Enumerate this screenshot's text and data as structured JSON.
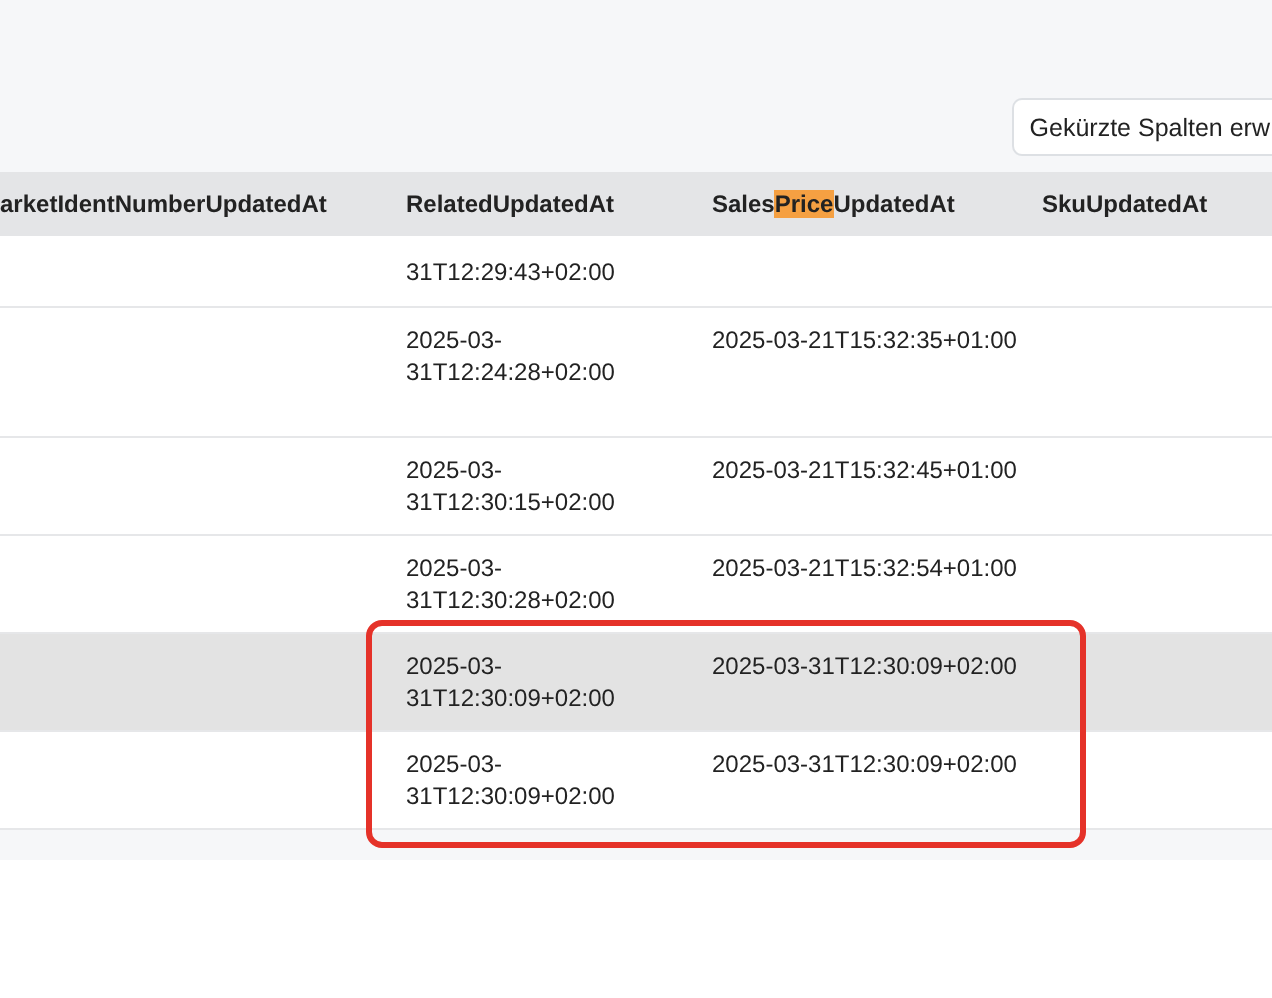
{
  "toolbar": {
    "button": "Gekürzte Spalten erw"
  },
  "table": {
    "columns": [
      {
        "parts": [
          {
            "text": "arketIdentNumberUpdatedAt",
            "highlighted": false
          }
        ]
      },
      {
        "parts": [
          {
            "text": "RelatedUpdatedAt",
            "highlighted": false
          }
        ]
      },
      {
        "parts": [
          {
            "text": "Sales",
            "highlighted": false
          },
          {
            "text": "Price",
            "highlighted": true
          },
          {
            "text": "UpdatedAt",
            "highlighted": false
          }
        ]
      },
      {
        "parts": [
          {
            "text": "SkuUpdatedAt",
            "highlighted": false
          }
        ]
      }
    ],
    "rows": [
      {
        "related": "31T12:29:43+02:00",
        "hovered": false
      },
      {
        "related": "2025-03-31T12:24:28+02:00",
        "sales_price": "2025-03-21T15:32:35+01:00",
        "hovered": false
      },
      {
        "related": "2025-03-31T12:30:15+02:00",
        "sales_price": "2025-03-21T15:32:45+01:00",
        "hovered": false
      },
      {
        "related": "2025-03-31T12:30:28+02:00",
        "sales_price": "2025-03-21T15:32:54+01:00",
        "hovered": false
      },
      {
        "related": "2025-03-31T12:30:09+02:00",
        "sales_price": "2025-03-31T12:30:09+02:00",
        "hovered": true
      },
      {
        "related": "2025-03-31T12:30:09+02:00",
        "sales_price": "2025-03-31T12:30:09+02:00",
        "hovered": false
      }
    ]
  }
}
